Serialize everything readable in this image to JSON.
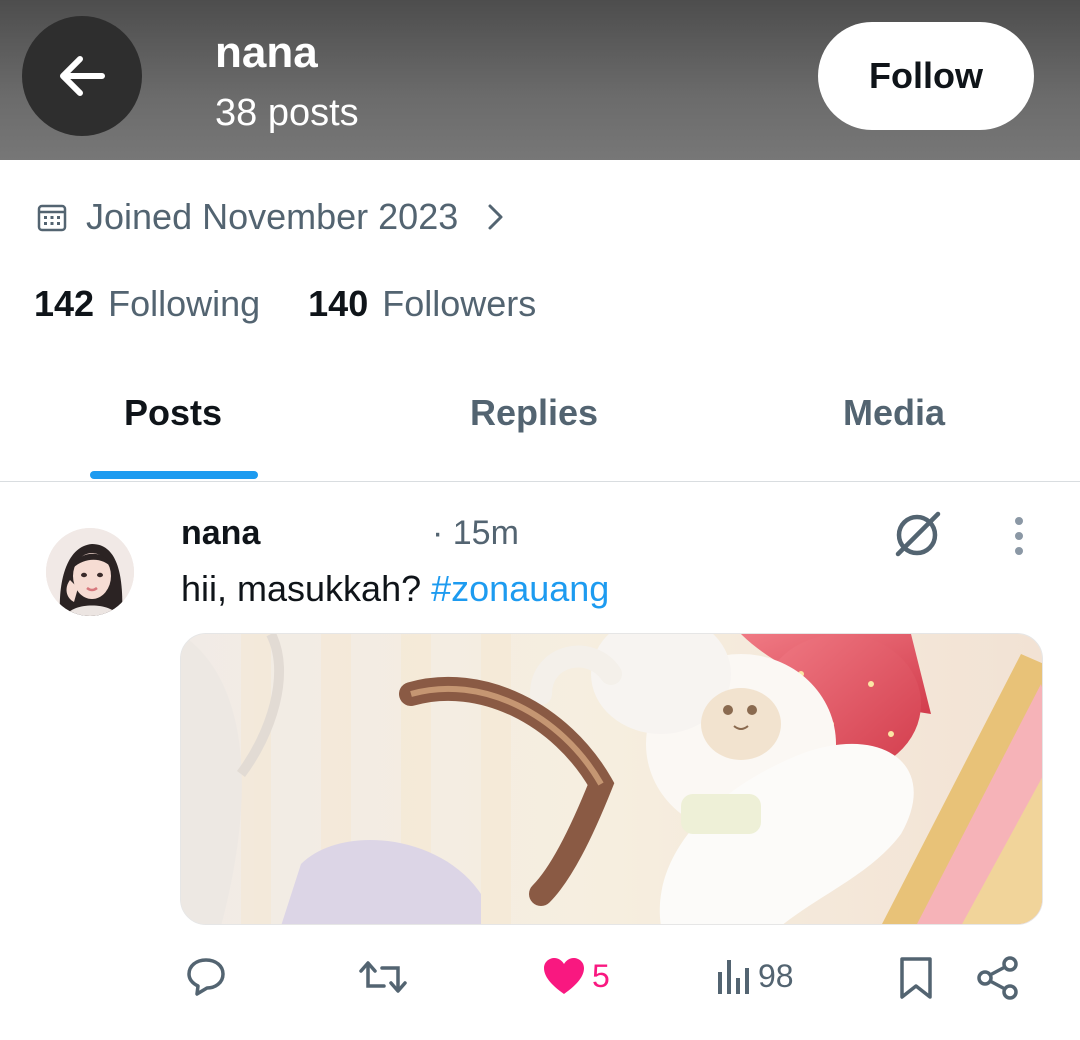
{
  "header": {
    "name": "nana",
    "posts_count": "38 posts",
    "follow_label": "Follow"
  },
  "profile": {
    "joined": "Joined November 2023",
    "following_count": "142",
    "following_label": "Following",
    "followers_count": "140",
    "followers_label": "Followers"
  },
  "tabs": [
    {
      "label": "Posts",
      "active": true
    },
    {
      "label": "Replies",
      "active": false
    },
    {
      "label": "Media",
      "active": false
    }
  ],
  "post": {
    "author": "nana",
    "time": "· 15m",
    "text": "hii, masukkah?",
    "hashtag": "#zonauang",
    "actions": {
      "reply_count": "",
      "repost_count": "",
      "like_count": "5",
      "view_count": "98"
    }
  },
  "icons": {
    "back": "arrow-left-icon",
    "calendar": "calendar-icon",
    "chevron": "chevron-right-icon",
    "grok": "grok-icon",
    "more": "more-vertical-icon",
    "reply": "reply-icon",
    "repost": "repost-icon",
    "like": "heart-icon",
    "views": "views-icon",
    "bookmark": "bookmark-icon",
    "share": "share-icon"
  },
  "colors": {
    "accent": "#1d9bf0",
    "like": "#f91880",
    "secondary_text": "#536471",
    "primary_text": "#0f1419"
  }
}
